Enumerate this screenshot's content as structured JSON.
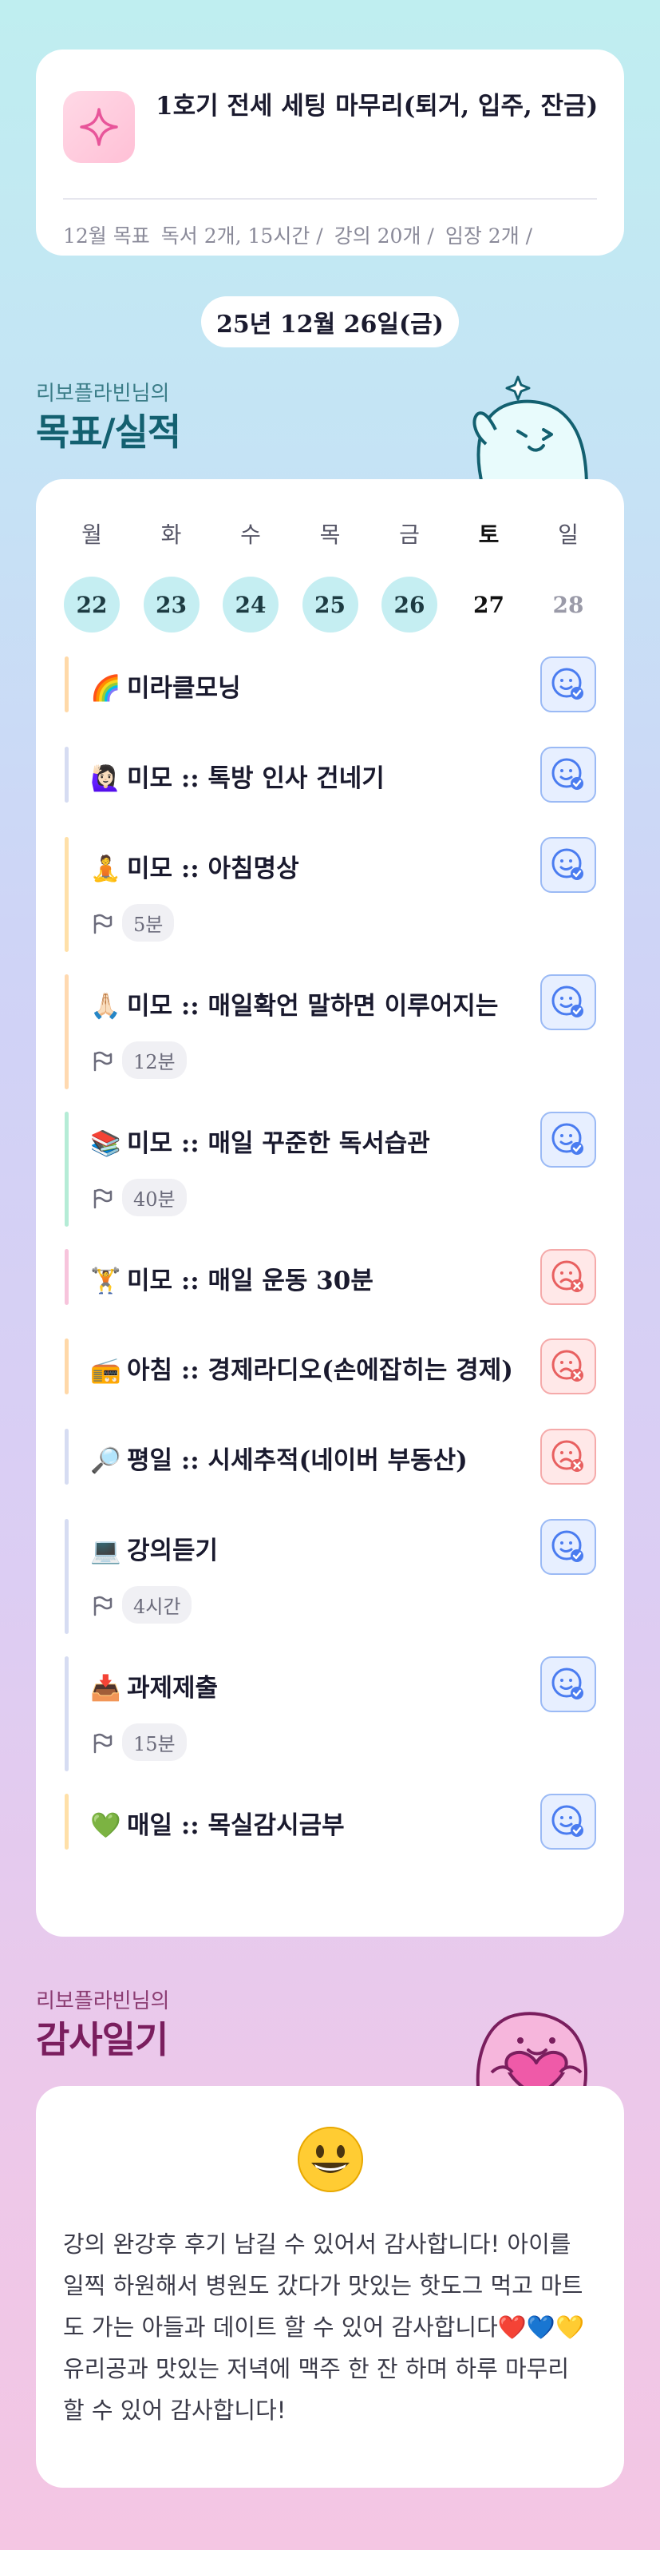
{
  "goal": {
    "icon": "sparkle-icon",
    "title": "1호기 전세 세팅 마무리(퇴거, 입주, 잔금)",
    "items": [
      "12월 목표",
      "독서 2개, 15시간 /",
      "강의 20개 /",
      "임장 2개 /"
    ]
  },
  "date": "25년 12월 26일(금)",
  "performance": {
    "subtitle": "리보플라빈님의",
    "title": "목표/실적",
    "week": {
      "days": [
        "월",
        "화",
        "수",
        "목",
        "금",
        "토",
        "일"
      ],
      "dates": [
        "22",
        "23",
        "24",
        "25",
        "26",
        "27",
        "28"
      ],
      "states": [
        "done",
        "done",
        "done",
        "done",
        "done",
        "today",
        "future"
      ]
    },
    "tasks": [
      {
        "emoji": "🌈",
        "title": "미라클모닝",
        "duration": "",
        "status": "success",
        "bar": "#ffd9a8"
      },
      {
        "emoji": "🙋🏻‍♀️",
        "title": "미모 :: 톡방 인사 건네기",
        "duration": "",
        "status": "success",
        "bar": "#d6dcf2"
      },
      {
        "emoji": "🧘",
        "title": "미모 :: 아침명상",
        "duration": "5분",
        "status": "success",
        "bar": "#ffe0a8"
      },
      {
        "emoji": "🙏🏻",
        "title": "미모 :: 매일확언 말하면 이루어지는",
        "duration": "12분",
        "status": "success",
        "bar": "#ffd9b0"
      },
      {
        "emoji": "📚",
        "title": "미모 :: 매일 꾸준한 독서습관",
        "duration": "40분",
        "status": "success",
        "bar": "#b5ecd6"
      },
      {
        "emoji": "🏋️",
        "title": "미모 :: 매일 운동 30분",
        "duration": "",
        "status": "fail",
        "bar": "#f7c4dc"
      },
      {
        "emoji": "📻",
        "title": "아침 :: 경제라디오(손에잡히는 경제)",
        "duration": "",
        "status": "fail",
        "bar": "#ffd8a8"
      },
      {
        "emoji": "🔎",
        "title": "평일 :: 시세추적(네이버 부동산)",
        "duration": "",
        "status": "fail",
        "bar": "#d6dcf2"
      },
      {
        "emoji": "💻",
        "title": "강의듣기",
        "duration": "4시간",
        "status": "success",
        "bar": "#d6dcf2"
      },
      {
        "emoji": "📥",
        "title": "과제제출",
        "duration": "15분",
        "status": "success",
        "bar": "#d6dcf2"
      },
      {
        "emoji": "💚",
        "title": "매일 :: 목실감시금부",
        "duration": "",
        "status": "success",
        "bar": "#ffe0a8"
      }
    ]
  },
  "gratitude": {
    "subtitle": "리보플라빈님의",
    "title": "감사일기",
    "mood_icon": "smiling-face-icon",
    "text": "강의 완강후 후기 남길 수 있어서 감사합니다! 아이를 일찍 하원해서 병원도 갔다가 맛있는 핫도그 먹고 마트도 가는 아들과 데이트 할 수 있어 감사합니다❤️💙💛 유리공과 맛있는 저녁에 맥주 한 잔 하며 하루 마무리 할 수 있어 감사합니다!"
  },
  "colors": {
    "accent_teal": "#136070",
    "accent_plum": "#7a1e5e",
    "success_blue": "#4a7cf0",
    "fail_red": "#e86060"
  }
}
